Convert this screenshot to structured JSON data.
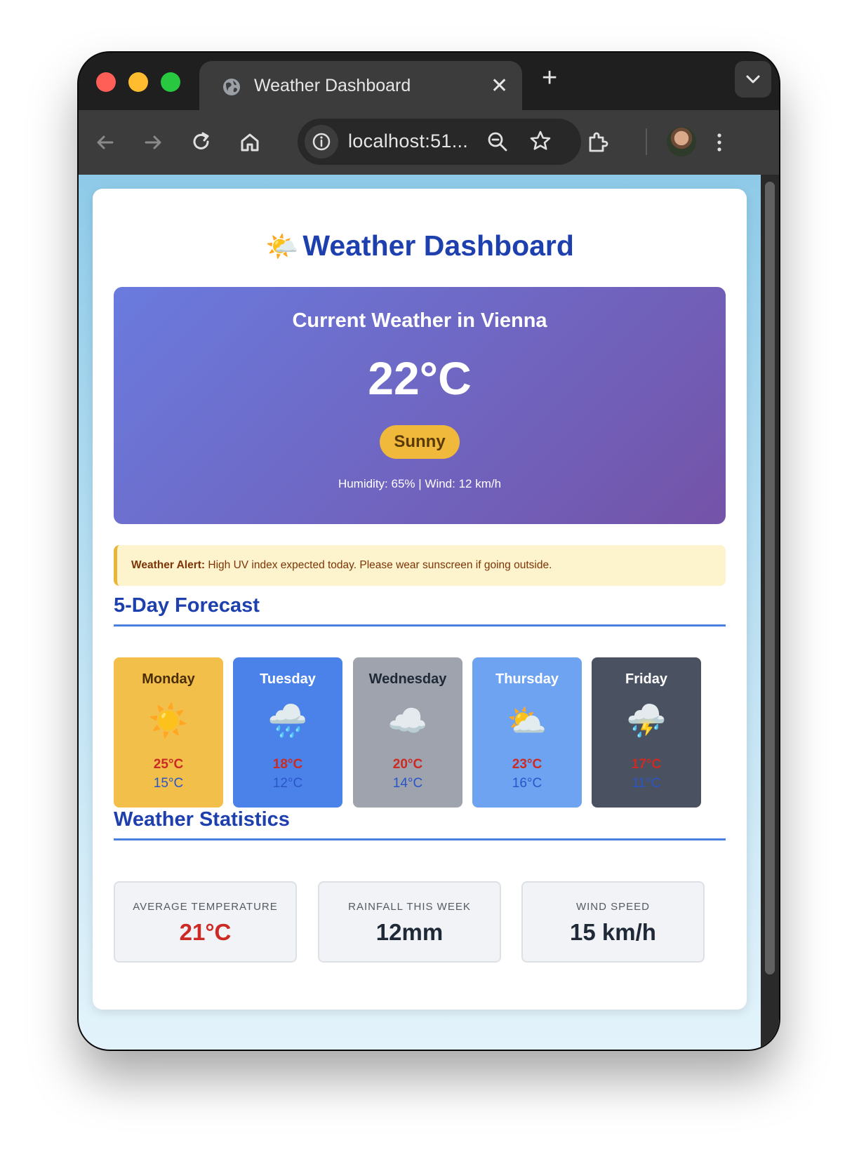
{
  "browser": {
    "tab_title": "Weather Dashboard",
    "tab_icon": "globe-icon",
    "close_label": "✕",
    "new_tab_label": "+",
    "address": "localhost:51..."
  },
  "page": {
    "title": "Weather Dashboard",
    "title_icon": "🌤️",
    "current": {
      "heading": "Current Weather in Vienna",
      "temperature": "22°C",
      "condition": "Sunny",
      "details": "Humidity: 65% | Wind: 12 km/h",
      "gradient_start": "#6a7bde",
      "gradient_end": "#7453a8",
      "condition_color": "#f0b93b"
    },
    "alert": {
      "label": "Weather Alert:",
      "message": " High UV index expected today. Please wear sunscreen if going outside.",
      "background": "#fdf3cd",
      "border": "#eab63a"
    },
    "forecast_title": "5-Day Forecast",
    "forecast": [
      {
        "day": "Monday",
        "icon": "☀️",
        "icon_name": "sun-icon",
        "high": "25°C",
        "low": "15°C",
        "bg": "#f2c04a",
        "text": "#4a2c05"
      },
      {
        "day": "Tuesday",
        "icon": "🌧️",
        "icon_name": "rain-cloud-icon",
        "high": "18°C",
        "low": "12°C",
        "bg": "#4b82ea",
        "text": "#ffffff"
      },
      {
        "day": "Wednesday",
        "icon": "☁️",
        "icon_name": "cloud-icon",
        "high": "20°C",
        "low": "14°C",
        "bg": "#9ea3ad",
        "text": "#1f2937"
      },
      {
        "day": "Thursday",
        "icon": "⛅",
        "icon_name": "partly-cloudy-icon",
        "high": "23°C",
        "low": "16°C",
        "bg": "#6ea3f2",
        "text": "#ffffff"
      },
      {
        "day": "Friday",
        "icon": "⛈️",
        "icon_name": "thunderstorm-icon",
        "high": "17°C",
        "low": "11°C",
        "bg": "#4a5261",
        "text": "#ffffff"
      }
    ],
    "stats_title": "Weather Statistics",
    "stats": [
      {
        "label": "AVERAGE TEMPERATURE",
        "value": "21°C",
        "color": "#cc2a24"
      },
      {
        "label": "RAINFALL THIS WEEK",
        "value": "12mm",
        "color": "#1f2937"
      },
      {
        "label": "WIND SPEED",
        "value": "15 km/h",
        "color": "#1f2937"
      }
    ]
  }
}
